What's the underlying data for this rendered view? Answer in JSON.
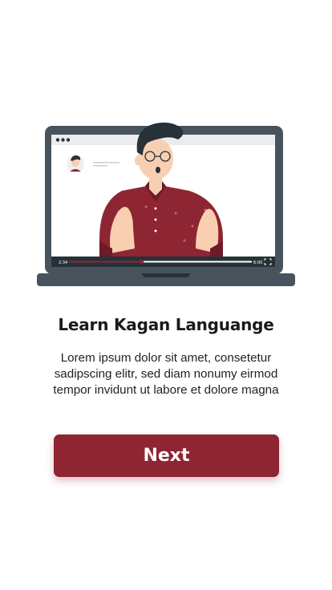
{
  "onboarding": {
    "title": "Learn Kagan Languange",
    "description_lines": [
      "Lorem ipsum dolor sit amet, consetetur",
      "sadipscing elitr, sed diam nonumy eirmod",
      "tempor invidunt ut labore et dolore magna"
    ],
    "next_label": "Next"
  },
  "video_player": {
    "elapsed_time": "2:34",
    "total_time": "6:00",
    "progress_fraction": 0.4
  },
  "colors": {
    "accent": "#8e2532",
    "laptop_frame": "#47545e",
    "shirt": "#8e2532",
    "skin": "#f8cfb0",
    "hair": "#263238"
  },
  "icons": [
    "window-dots-icon",
    "fullscreen-icon"
  ]
}
